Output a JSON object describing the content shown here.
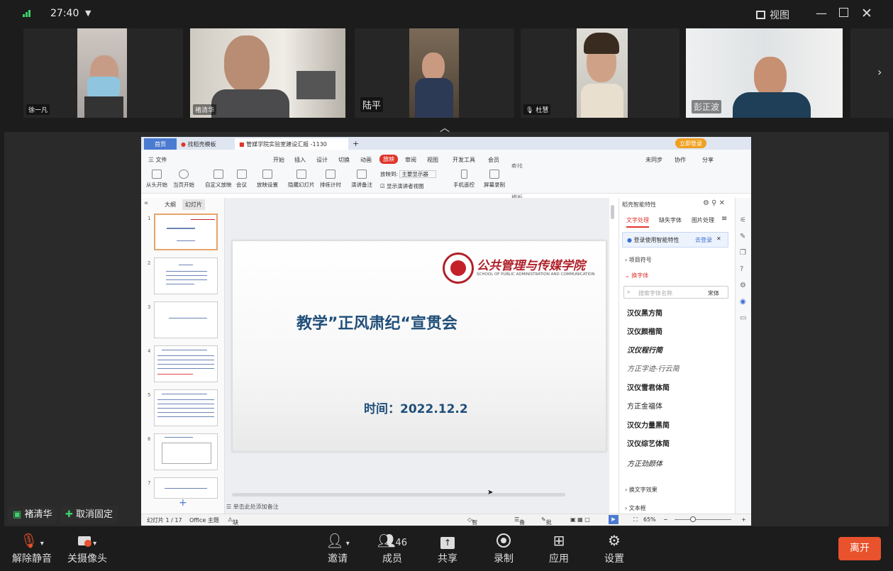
{
  "topbar": {
    "time": "27:40",
    "view_label": "视图"
  },
  "participants": [
    {
      "name": "徐一凡"
    },
    {
      "name": "褚清华"
    },
    {
      "name": "陆平"
    },
    {
      "name": "杜慧"
    },
    {
      "name": "彭正波"
    }
  ],
  "wps": {
    "tabs": {
      "home": "首页",
      "template": "找稻壳模板",
      "doc": "管媒学院实验室建设汇报 -1130",
      "login": "立即登录"
    },
    "menu": [
      "三 文件",
      "开始",
      "插入",
      "设计",
      "切换",
      "动画",
      "放映",
      "审阅",
      "视图",
      "开发工具",
      "会员",
      "查找命令、搜索模板",
      "未同步",
      "协作",
      "分享"
    ],
    "ribbon": [
      "从头开始",
      "当页开始",
      "自定义放映",
      "会议",
      "放映设置",
      "隐藏幻灯片",
      "排练计时",
      "演讲备注",
      "手机遥控",
      "屏幕录制"
    ],
    "ribbon_extra": {
      "to_label": "放映到:",
      "to_value": "主要显示器",
      "presenter_view": "显示演讲者视图"
    },
    "left_tabs": [
      "大纲",
      "幻灯片"
    ],
    "slide_numbers": [
      "1",
      "2",
      "3",
      "4",
      "5",
      "6",
      "7"
    ],
    "slide": {
      "logo_cn": "公共管理与传媒学院",
      "logo_en": "SCHOOL OF PUBLIC ADMINISTRATION AND COMMUNICATION",
      "title": "教学”正风肃纪“宣贯会",
      "date": "时间：2022.12.2"
    },
    "notes_placeholder": "单击此处添加备注",
    "right_panel": {
      "title": "稻壳智能特性",
      "tabs": [
        "文字处理",
        "缺失字体",
        "图片处理"
      ],
      "banner": "登录使用智能特性",
      "banner_link": "去登录",
      "section1": "项目符号",
      "section2": "换字体",
      "search_placeholder": "搜索字体名称",
      "search_scope": "宋体",
      "fonts": [
        "汉仪黑方简",
        "汉仪颜楷简",
        "汉仪程行简",
        "方正字迹-行云简",
        "汉仪雪君体简",
        "方正金福体",
        "汉仪力量黑简",
        "汉仪综艺体简",
        "方正劲颜体"
      ],
      "section3": "换文字效果",
      "section4": "文本框"
    },
    "status": {
      "slide_pos": "幻灯片 1 / 17",
      "theme": "Office 主题",
      "missing_font": "缺失字体",
      "beautify": "智能美化",
      "notes": "备注",
      "annotate": "批注",
      "zoom": "65%"
    }
  },
  "pills": {
    "speaker": "褚清华",
    "unpin": "取消固定"
  },
  "bottombar": {
    "mute": "解除静音",
    "camera": "关摄像头",
    "invite": "邀请",
    "members": "成员",
    "members_count": "46",
    "share": "共享",
    "record": "录制",
    "apps": "应用",
    "settings": "设置",
    "leave": "离开"
  },
  "colors": {
    "accent_leave": "#e8522c",
    "wps_red": "#e0352b",
    "slide_title": "#1f4e79"
  }
}
